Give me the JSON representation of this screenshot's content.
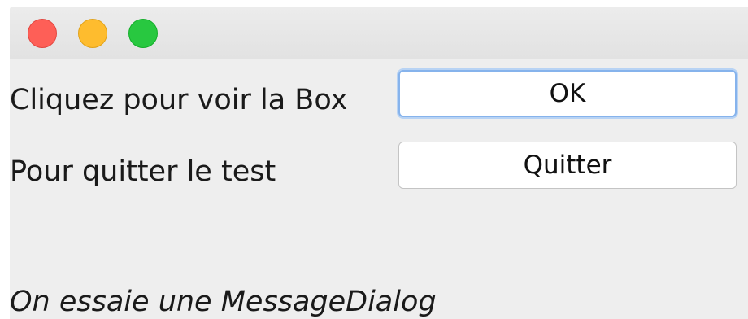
{
  "titlebar": {
    "buttons": [
      "close",
      "minimize",
      "zoom"
    ],
    "colors": {
      "close": "#fe5f57",
      "minimize": "#febc2e",
      "zoom": "#28c840"
    }
  },
  "rows": [
    {
      "label": "Cliquez pour voir la Box",
      "button": "OK",
      "focused": true
    },
    {
      "label": "Pour quitter le test",
      "button": "Quitter",
      "focused": false
    }
  ],
  "footer_text": "On essaie une MessageDialog",
  "accent_color": "#86b3ec"
}
